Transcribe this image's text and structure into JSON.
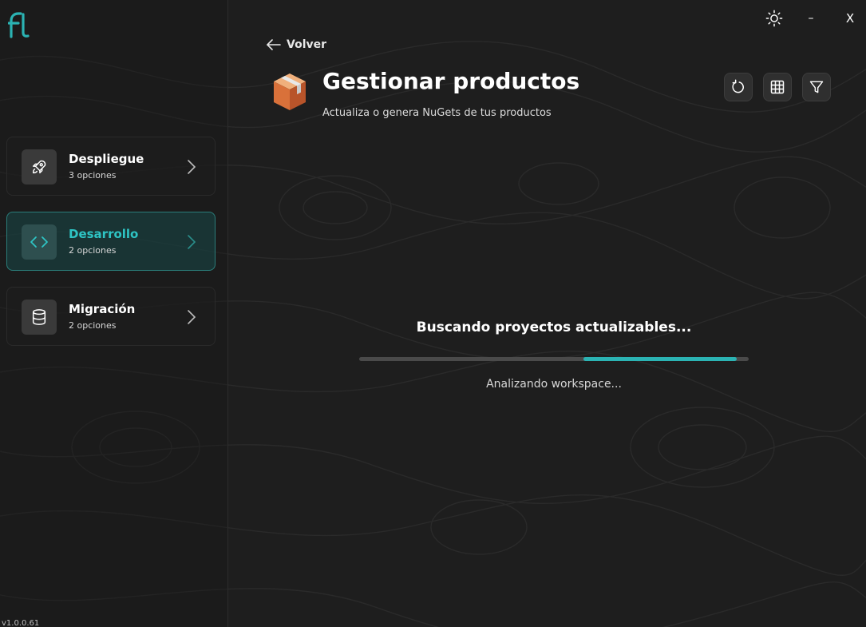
{
  "app": {
    "version": "v1.0.0.61"
  },
  "window_controls": {
    "theme_icon": "sun-icon",
    "minimize_label": "–",
    "close_label": "X"
  },
  "sidebar": {
    "items": [
      {
        "title": "Despliegue",
        "subtitle": "3 opciones",
        "icon": "rocket-icon",
        "active": false
      },
      {
        "title": "Desarrollo",
        "subtitle": "2 opciones",
        "icon": "code-icon",
        "active": true
      },
      {
        "title": "Migración",
        "subtitle": "2 opciones",
        "icon": "database-icon",
        "active": false
      }
    ]
  },
  "header": {
    "back_label": "Volver",
    "title": "Gestionar productos",
    "subtitle": "Actualiza o genera NuGets de tus productos",
    "icon": "package-icon"
  },
  "toolbar": {
    "buttons": [
      "refresh-icon",
      "grid-icon",
      "filter-icon"
    ]
  },
  "loading": {
    "title": "Buscando proyectos actualizables...",
    "status": "Analizando workspace...",
    "progress_start": 0.575,
    "progress_end": 0.97
  },
  "colors": {
    "accent": "#2bb3b3",
    "accent_text": "#2ec4c4",
    "background": "#1e1e1e",
    "active_item_bg": "#184848"
  }
}
